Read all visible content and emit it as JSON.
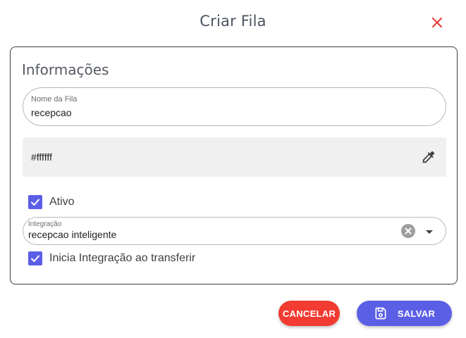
{
  "dialog": {
    "title": "Criar Fila"
  },
  "section": {
    "title": "Informações"
  },
  "name_field": {
    "label": "Nome da Fila",
    "value": "recepcao"
  },
  "color_field": {
    "value": "#ffffff",
    "icon": "eyedropper-icon"
  },
  "ativo": {
    "label": "Ativo",
    "checked": true
  },
  "integracao": {
    "label": "Integração",
    "value": "recepcao inteligente"
  },
  "inicia_integracao": {
    "label": "Inicia Integração ao transferir",
    "checked": true
  },
  "buttons": {
    "cancel_label": "CANCELAR",
    "save_label": "SALVAR"
  },
  "colors": {
    "accent": "#5b5fe6",
    "danger": "#f23b31",
    "close": "#e53935"
  }
}
